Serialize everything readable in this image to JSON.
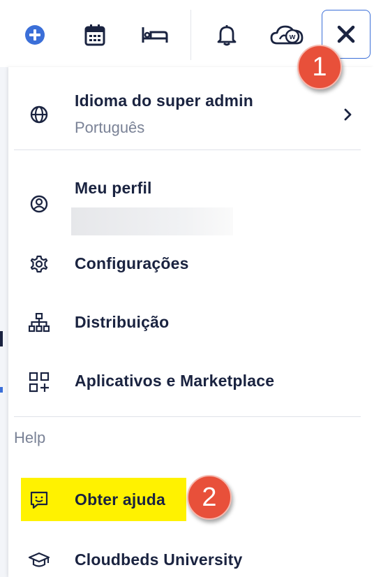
{
  "menu": {
    "language": {
      "label": "Idioma do super admin",
      "value": "Português"
    },
    "profile": {
      "label": "Meu perfil"
    },
    "settings": {
      "label": "Configurações"
    },
    "distribution": {
      "label": "Distribuição"
    },
    "apps": {
      "label": "Aplicativos e Marketplace"
    },
    "help_section": "Help",
    "get_help": {
      "label": "Obter ajuda"
    },
    "university": {
      "label": "Cloudbeds University"
    }
  },
  "callouts": {
    "first": "1",
    "second": "2"
  },
  "colors": {
    "accent": "#3b6fd8",
    "badge": "#e8503a",
    "highlight": "#fff200",
    "text": "#1a2340"
  }
}
